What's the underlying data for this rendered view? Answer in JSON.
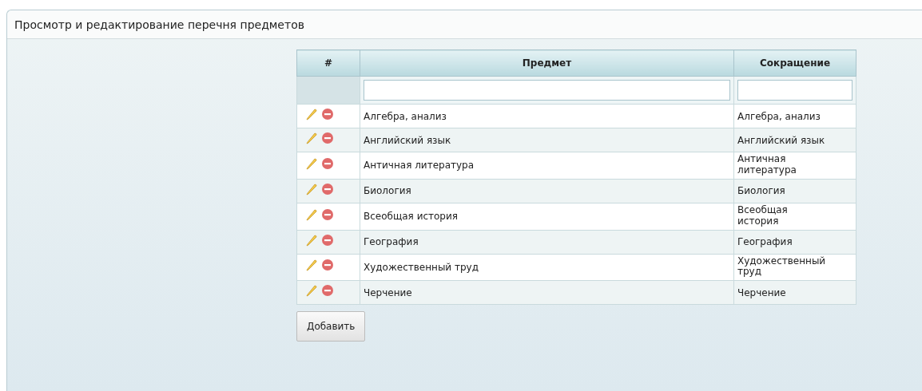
{
  "panel": {
    "title": "Просмотр и редактирование перечня предметов"
  },
  "table": {
    "columns": [
      "#",
      "Предмет",
      "Сокращение"
    ],
    "filters": [
      {
        "kind": "text"
      },
      {
        "kind": "text"
      }
    ],
    "rows": [
      {
        "subject": "Алгебра, анализ",
        "short": "Алгебра, анализ"
      },
      {
        "subject": "Английский язык",
        "short": "Английский язык"
      },
      {
        "subject": "Античная литература",
        "short": "Античная литература"
      },
      {
        "subject": "Биология",
        "short": "Биология"
      },
      {
        "subject": "Всеобщая история",
        "short": "Всеобщая история"
      },
      {
        "subject": "География",
        "short": "География"
      },
      {
        "subject": "Художественный труд",
        "short": "Художественный труд"
      },
      {
        "subject": "Черчение",
        "short": "Черчение"
      }
    ]
  },
  "add_button": "Добавить"
}
